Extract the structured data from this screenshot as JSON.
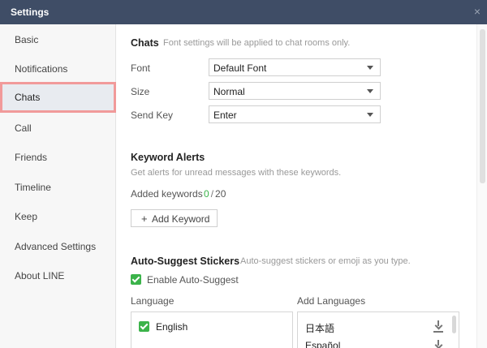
{
  "window": {
    "title": "Settings",
    "close_glyph": "×"
  },
  "sidebar": {
    "items": [
      {
        "label": "Basic",
        "active": false
      },
      {
        "label": "Notifications",
        "active": false
      },
      {
        "label": "Chats",
        "active": true
      },
      {
        "label": "Call",
        "active": false
      },
      {
        "label": "Friends",
        "active": false
      },
      {
        "label": "Timeline",
        "active": false
      },
      {
        "label": "Keep",
        "active": false
      },
      {
        "label": "Advanced Settings",
        "active": false
      },
      {
        "label": "About LINE",
        "active": false
      }
    ]
  },
  "chats": {
    "title": "Chats",
    "subtitle": "Font settings will be applied to chat rooms only.",
    "font_label": "Font",
    "font_value": "Default Font",
    "size_label": "Size",
    "size_value": "Normal",
    "sendkey_label": "Send Key",
    "sendkey_value": "Enter"
  },
  "keyword_alerts": {
    "title": "Keyword Alerts",
    "subtitle": "Get alerts for unread messages with these keywords.",
    "added_label": "Added keywords",
    "added_count": "0",
    "separator": "/",
    "max_count": "20",
    "add_plus": "+",
    "add_button": "Add Keyword"
  },
  "auto_suggest": {
    "title": "Auto-Suggest Stickers",
    "subtitle": "Auto-suggest stickers or emoji as you type.",
    "enable_label": "Enable Auto-Suggest",
    "enabled": true,
    "language_header": "Language",
    "add_languages_header": "Add Languages",
    "selected_languages": [
      "English"
    ],
    "available_languages": [
      "日本語",
      "Español"
    ]
  },
  "colors": {
    "titlebar": "#3f4d66",
    "accent_green": "#3bb34a",
    "highlight": "#f19a9a"
  },
  "icons": {
    "close": "close-icon",
    "download": "download-icon",
    "check": "checkbox-checked-icon"
  }
}
